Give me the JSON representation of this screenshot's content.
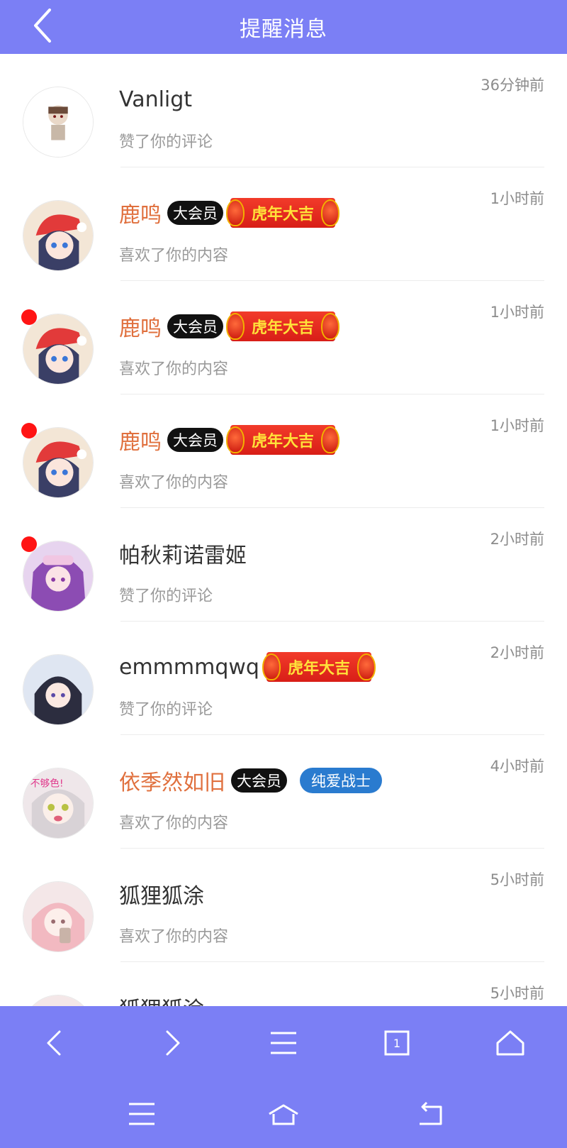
{
  "header": {
    "title": "提醒消息",
    "back_icon": "chevron-left-icon"
  },
  "badges": {
    "vip": "大会员",
    "tiger": "虎年大吉",
    "chunai": "纯爱战士"
  },
  "notifications": [
    {
      "name": "Vanligt",
      "action": "赞了你的评论",
      "time": "36分钟前",
      "unread": false,
      "vip": false,
      "tiger": false
    },
    {
      "name": "鹿鸣",
      "action": "喜欢了你的内容",
      "time": "1小时前",
      "unread": false,
      "vip": true,
      "tiger": true
    },
    {
      "name": "鹿鸣",
      "action": "喜欢了你的内容",
      "time": "1小时前",
      "unread": true,
      "vip": true,
      "tiger": true
    },
    {
      "name": "鹿鸣",
      "action": "喜欢了你的内容",
      "time": "1小时前",
      "unread": true,
      "vip": true,
      "tiger": true
    },
    {
      "name": "帕秋莉诺雷姬",
      "action": "赞了你的评论",
      "time": "2小时前",
      "unread": true,
      "vip": false,
      "tiger": false
    },
    {
      "name": "emmmmqwq",
      "action": "赞了你的评论",
      "time": "2小时前",
      "unread": false,
      "vip": false,
      "tiger": true
    },
    {
      "name": "依季然如旧",
      "action": "喜欢了你的内容",
      "time": "4小时前",
      "unread": false,
      "vip": true,
      "tiger": false,
      "blue_badge": true
    },
    {
      "name": "狐狸狐涂",
      "action": "喜欢了你的内容",
      "time": "5小时前",
      "unread": false,
      "vip": false,
      "tiger": false
    },
    {
      "name": "狐狸狐涂",
      "action": "",
      "time": "5小时前",
      "unread": false,
      "vip": false,
      "tiger": false
    }
  ],
  "browser_toolbar": {
    "icons": [
      "chevron-left-icon",
      "chevron-right-icon",
      "menu-icon",
      "tabs-icon",
      "home-icon"
    ],
    "tab_count": "1"
  },
  "system_nav": {
    "icons": [
      "menu-icon",
      "home-icon",
      "back-icon"
    ]
  },
  "colors": {
    "header_bg": "#7b7ff5",
    "vip_name": "#e0703e",
    "unread_dot": "#ff1414"
  }
}
